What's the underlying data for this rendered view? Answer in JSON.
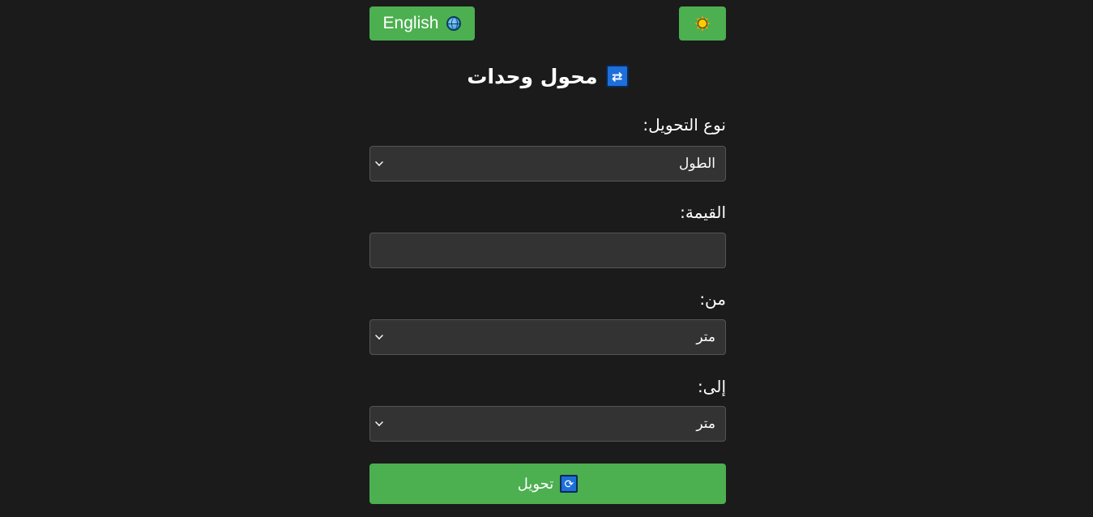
{
  "header": {
    "language_button": "English",
    "language_icon": "globe-icon",
    "theme_icon": "sun-icon"
  },
  "title": {
    "text": "محول وحدات",
    "icon": "repeat-icon"
  },
  "form": {
    "conversion_type": {
      "label": "نوع التحويل:",
      "selected": "الطول"
    },
    "value": {
      "label": "القيمة:",
      "value": "",
      "placeholder": ""
    },
    "from": {
      "label": "من:",
      "selected": "متر"
    },
    "to": {
      "label": "إلى:",
      "selected": "متر"
    }
  },
  "convert_button": {
    "label": "تحويل",
    "icon": "refresh-icon"
  },
  "colors": {
    "background": "#1b1b1b",
    "accent": "#4caf50",
    "control_bg": "#333333",
    "control_border": "#555555"
  }
}
